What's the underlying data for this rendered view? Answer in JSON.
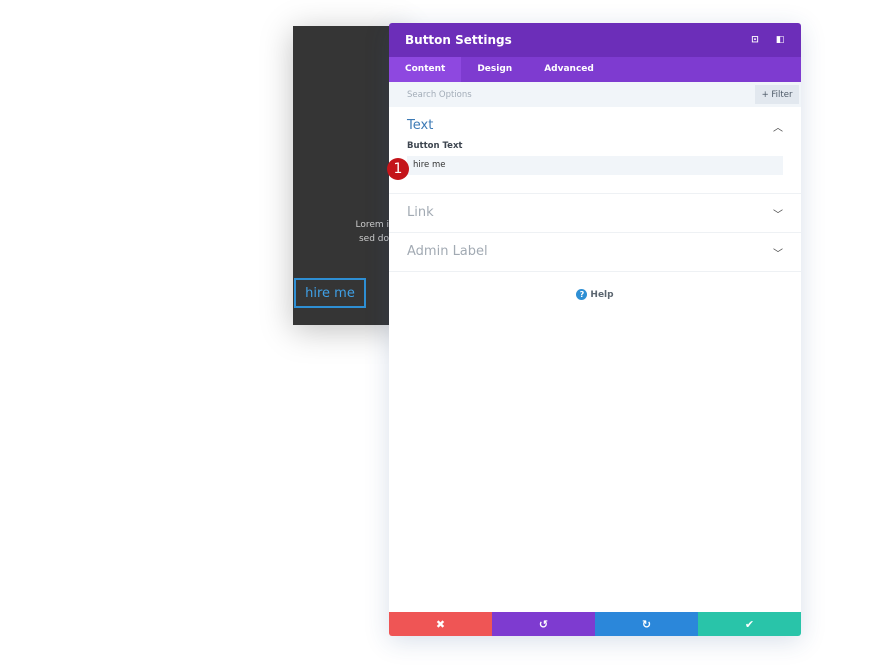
{
  "preview": {
    "lorem_line1": "Lorem i",
    "lorem_line2": "sed do",
    "button_text": "hire me"
  },
  "panel": {
    "title": "Button Settings",
    "tabs": [
      {
        "label": "Content",
        "active": true
      },
      {
        "label": "Design"
      },
      {
        "label": "Advanced"
      }
    ],
    "search_placeholder": "Search Options",
    "filter_label": "+ Filter",
    "sections": {
      "text": {
        "title": "Text",
        "field_label": "Button Text",
        "field_value": "hire me"
      },
      "link": {
        "title": "Link"
      },
      "admin": {
        "title": "Admin Label"
      }
    },
    "step_badge": "1",
    "help_label": "Help",
    "footer": {
      "cancel": "✖",
      "undo": "↺",
      "redo": "↻",
      "save": "✔"
    }
  },
  "colors": {
    "header": "#6c2eb9",
    "tabs": "#7e3bd0",
    "cancel": "#ef5555",
    "undo": "#7e3bd0",
    "redo": "#2b87da",
    "save": "#29c4a9"
  }
}
